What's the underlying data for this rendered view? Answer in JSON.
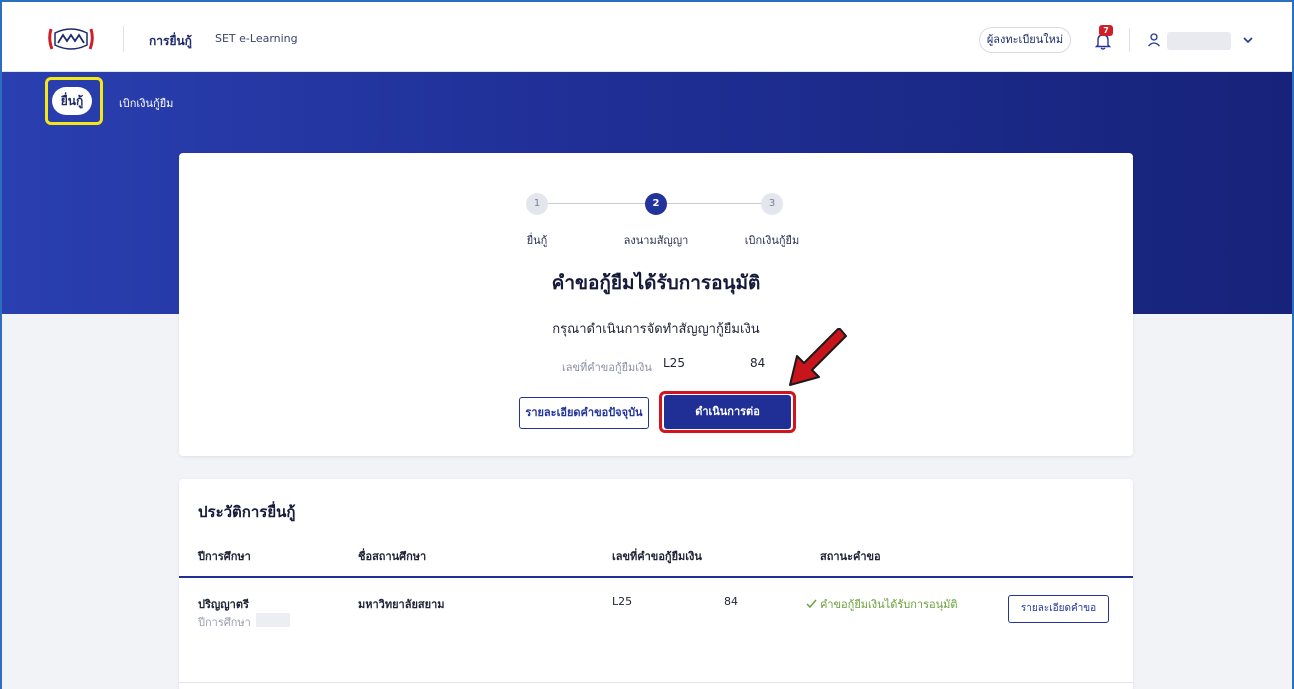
{
  "nav": {
    "links": [
      "การยื่นกู้",
      "SET e-Learning"
    ],
    "register_label": "ผู้ลงทะเบียนใหม่",
    "notification_count": "7",
    "icons": {
      "logo": "agency-logo-icon",
      "bell": "bell-icon",
      "user": "user-icon",
      "chevron": "chevron-down-icon"
    }
  },
  "subnav": {
    "active": "ยื่นกู้",
    "other": "เบิกเงินกู้ยืม"
  },
  "stepper": {
    "steps": [
      {
        "num": "1",
        "label": "ยื่นกู้",
        "state": "inactive"
      },
      {
        "num": "2",
        "label": "ลงนามสัญญา",
        "state": "active"
      },
      {
        "num": "3",
        "label": "เบิกเงินกู้ยืม",
        "state": "inactive"
      }
    ]
  },
  "card": {
    "title": "คำขอกู้ยืมได้รับการอนุมัติ",
    "subtitle": "กรุณาดำเนินการจัดทำสัญญากู้ยืมเงิน",
    "request_label": "เลขที่คำขอกู้ยืมเงิน",
    "request_prefix": "L25",
    "request_suffix": "84",
    "btn_details": "รายละเอียดคำขอปัจจุบัน",
    "btn_continue": "ดำเนินการต่อ"
  },
  "history": {
    "title": "ประวัติการยื่นกู้",
    "columns": [
      "ปีการศึกษา",
      "ชื่อสถานศึกษา",
      "เลขที่คำขอกู้ยืมเงิน",
      "สถานะคำขอ"
    ],
    "rows": [
      {
        "level": "ปริญญาตรี",
        "year_label": "ปีการศึกษา",
        "institution": "มหาวิทยาลัยสยาม",
        "request_prefix": "L25",
        "request_suffix": "84",
        "status": "คำขอกู้ยืมเงินได้รับการอนุมัติ",
        "action": "รายละเอียดคำขอ"
      }
    ]
  },
  "colors": {
    "primary": "#1f2f96",
    "highlight_yellow": "#f4e718",
    "highlight_red": "#d3141e",
    "status_green": "#6aa13a"
  }
}
